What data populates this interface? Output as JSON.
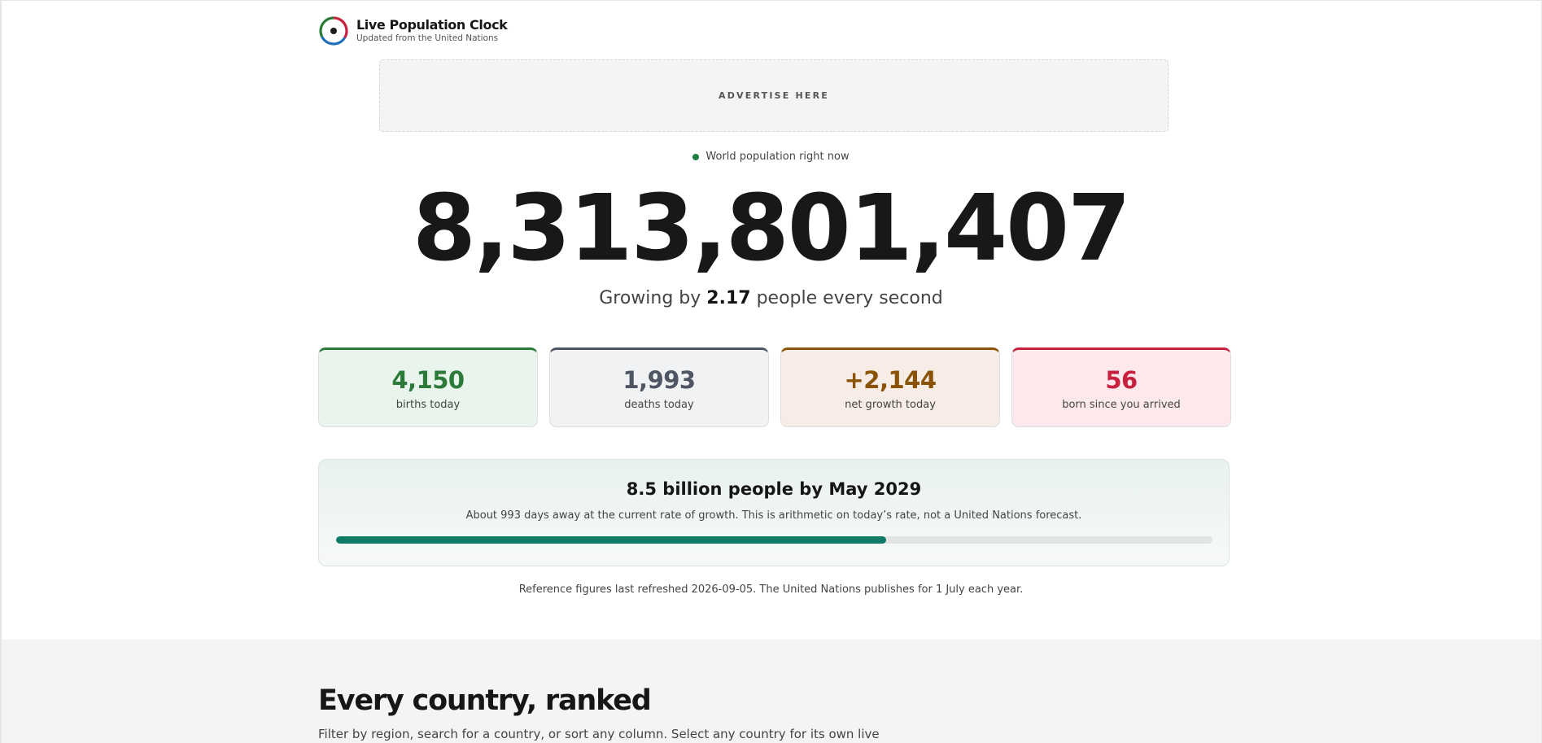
{
  "header": {
    "title": "Live Population Clock",
    "subtitle": "Updated from the United Nations",
    "logo_icon": "population-ring-icon"
  },
  "ad": {
    "label": "ADVERTISE HERE"
  },
  "hero": {
    "live_label": "World population right now",
    "live_color": "#1e7e3e",
    "population": "8,313,801,407",
    "growth_prefix": "Growing by ",
    "growth_rate": "2.17",
    "growth_suffix": " people every second"
  },
  "stats": [
    {
      "value": "4,150",
      "label": "births today",
      "color": "#2c7a3a",
      "bg": "#e9f4ec",
      "accent": "#2c7a3a"
    },
    {
      "value": "1,993",
      "label": "deaths today",
      "color": "#4f5663",
      "bg": "#f1f2f4",
      "accent": "#4f5663"
    },
    {
      "value": "+2,144",
      "label": "net growth today",
      "color": "#8a5205",
      "bg": "#f7ede6",
      "accent": "#8a5205"
    },
    {
      "value": "56",
      "label": "born since you arrived",
      "color": "#c8213f",
      "bg": "#fde9ec",
      "accent": "#c8213f"
    }
  ],
  "milestone": {
    "title": "8.5 billion people by May 2029",
    "description": "About 993 days away at the current rate of growth. This is arithmetic on today’s rate, not a United Nations forecast.",
    "progress": 0.628,
    "progress_color": "#0f7a66"
  },
  "refresh_note": "Reference figures last refreshed 2026-09-05. The United Nations publishes for 1 July each year.",
  "countries_section": {
    "title": "Every country, ranked",
    "description": "Filter by region, search for a country, or sort any column. Select any country for its own live"
  }
}
